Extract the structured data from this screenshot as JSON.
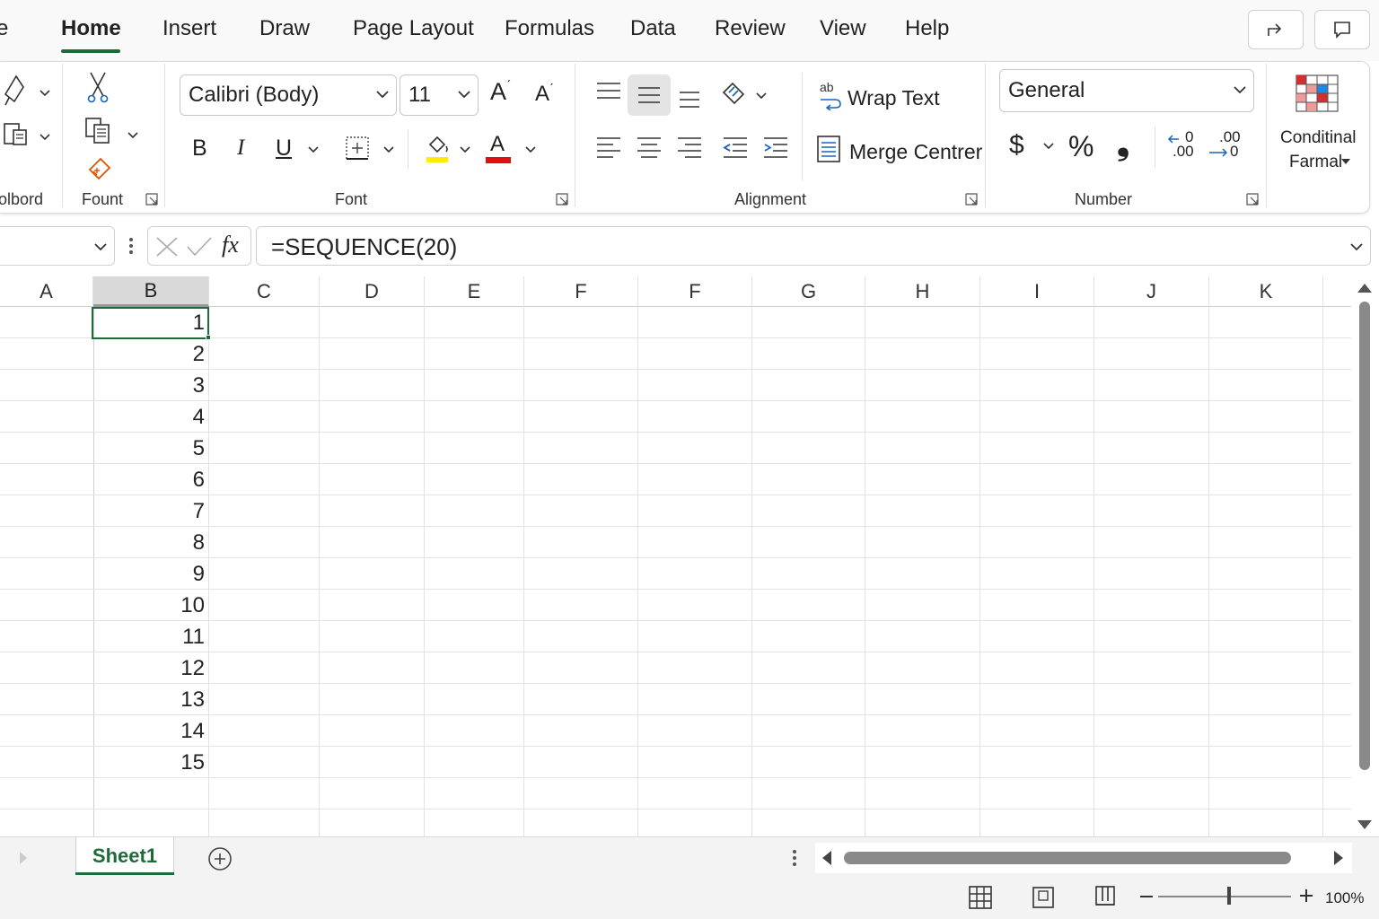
{
  "ribbon_tabs": [
    "e",
    "Home",
    "Insert",
    "Draw",
    "Page Layout",
    "Formulas",
    "Data",
    "Review",
    "View",
    "Help"
  ],
  "active_tab": "Home",
  "accent_color": "#1e6b3a",
  "clipboard": {
    "label": "olbord"
  },
  "clipboard2": {
    "label": "Fount"
  },
  "font": {
    "label": "Font",
    "family": "Calibri (Body)",
    "size": "11",
    "bold": "B",
    "italic": "I",
    "underline": "U",
    "grow": "A",
    "shrink": "A",
    "fill_color": "#ffee00",
    "font_color": "#e01010",
    "font_color_letter": "A"
  },
  "alignment": {
    "label": "Alignment",
    "wrap_text": "Wrap Text",
    "merge_center": "Merge Centrer"
  },
  "number": {
    "label": "Number",
    "format": "General",
    "currency": "$",
    "percent": "%",
    "comma": "❟",
    "inc_decimal_top": "0",
    "inc_decimal_bottom": ".00",
    "dec_decimal_top": ".00",
    "dec_decimal_bottom": "0"
  },
  "styles": {
    "conditional_line1": "Conditinal",
    "conditional_line2": "Farmal"
  },
  "formula_bar": {
    "name_box": "",
    "fx": "fx",
    "formula": "=SEQUENCE(20)"
  },
  "columns": [
    "A",
    "B",
    "C",
    "D",
    "E",
    "F",
    "F",
    "G",
    "H",
    "I",
    "J",
    "K"
  ],
  "selected_column": "B",
  "cells_b": [
    "1",
    "2",
    "3",
    "4",
    "5",
    "6",
    "7",
    "8",
    "9",
    "10",
    "11",
    "12",
    "13",
    "14",
    "15"
  ],
  "sheet": {
    "name": "Sheet1"
  },
  "status": {
    "zoom": "100%"
  }
}
